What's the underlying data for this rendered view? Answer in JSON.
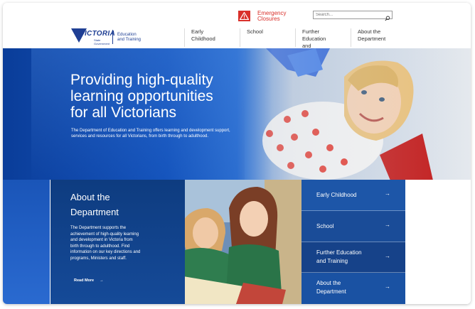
{
  "header": {
    "alert_line1": "Emergency",
    "alert_line2": "Closures",
    "search_placeholder": "Search...",
    "logo": {
      "wordmark": "VICTORIA",
      "sub_line1": "State",
      "sub_line2": "Government",
      "dept_line1": "Education",
      "dept_line2": "and Training"
    }
  },
  "nav": {
    "items": [
      {
        "line1": "Early Childhood",
        "line2": ""
      },
      {
        "line1": "School",
        "line2": ""
      },
      {
        "line1": "Further Education",
        "line2": "and Training"
      },
      {
        "line1": "About the",
        "line2": "Department"
      }
    ]
  },
  "hero": {
    "title_line1": "Providing high-quality",
    "title_line2": "learning opportunities",
    "title_line3": "for all Victorians",
    "desc_line1": "The Department of Education and Training offers learning and development support,",
    "desc_line2": "services and resources for all Victorians, from birth through to adulthood."
  },
  "about": {
    "title_line1": "About the",
    "title_line2": "Department",
    "text": [
      "The Department supports the",
      "achievement of high-quality learning",
      "and development in Victoria from",
      "birth through to adulthood. Find",
      "information on our key directions and",
      "programs, Ministers and staff."
    ],
    "read_more": "Read More"
  },
  "side_nav": [
    {
      "line1": "Early Childhood",
      "line2": "",
      "color": "#1d56a8"
    },
    {
      "line1": "School",
      "line2": "",
      "color": "#1a4c98"
    },
    {
      "line1": "Further Education",
      "line2": "and Training",
      "color": "#164289"
    },
    {
      "line1": "About the",
      "line2": "Department",
      "color": "#1a52a3"
    }
  ],
  "colors": {
    "brand_blue": "#1f3f94",
    "alert_red": "#d9302a"
  },
  "icons": [
    "alert-triangle-icon",
    "search-icon",
    "arrow-right-icon"
  ]
}
